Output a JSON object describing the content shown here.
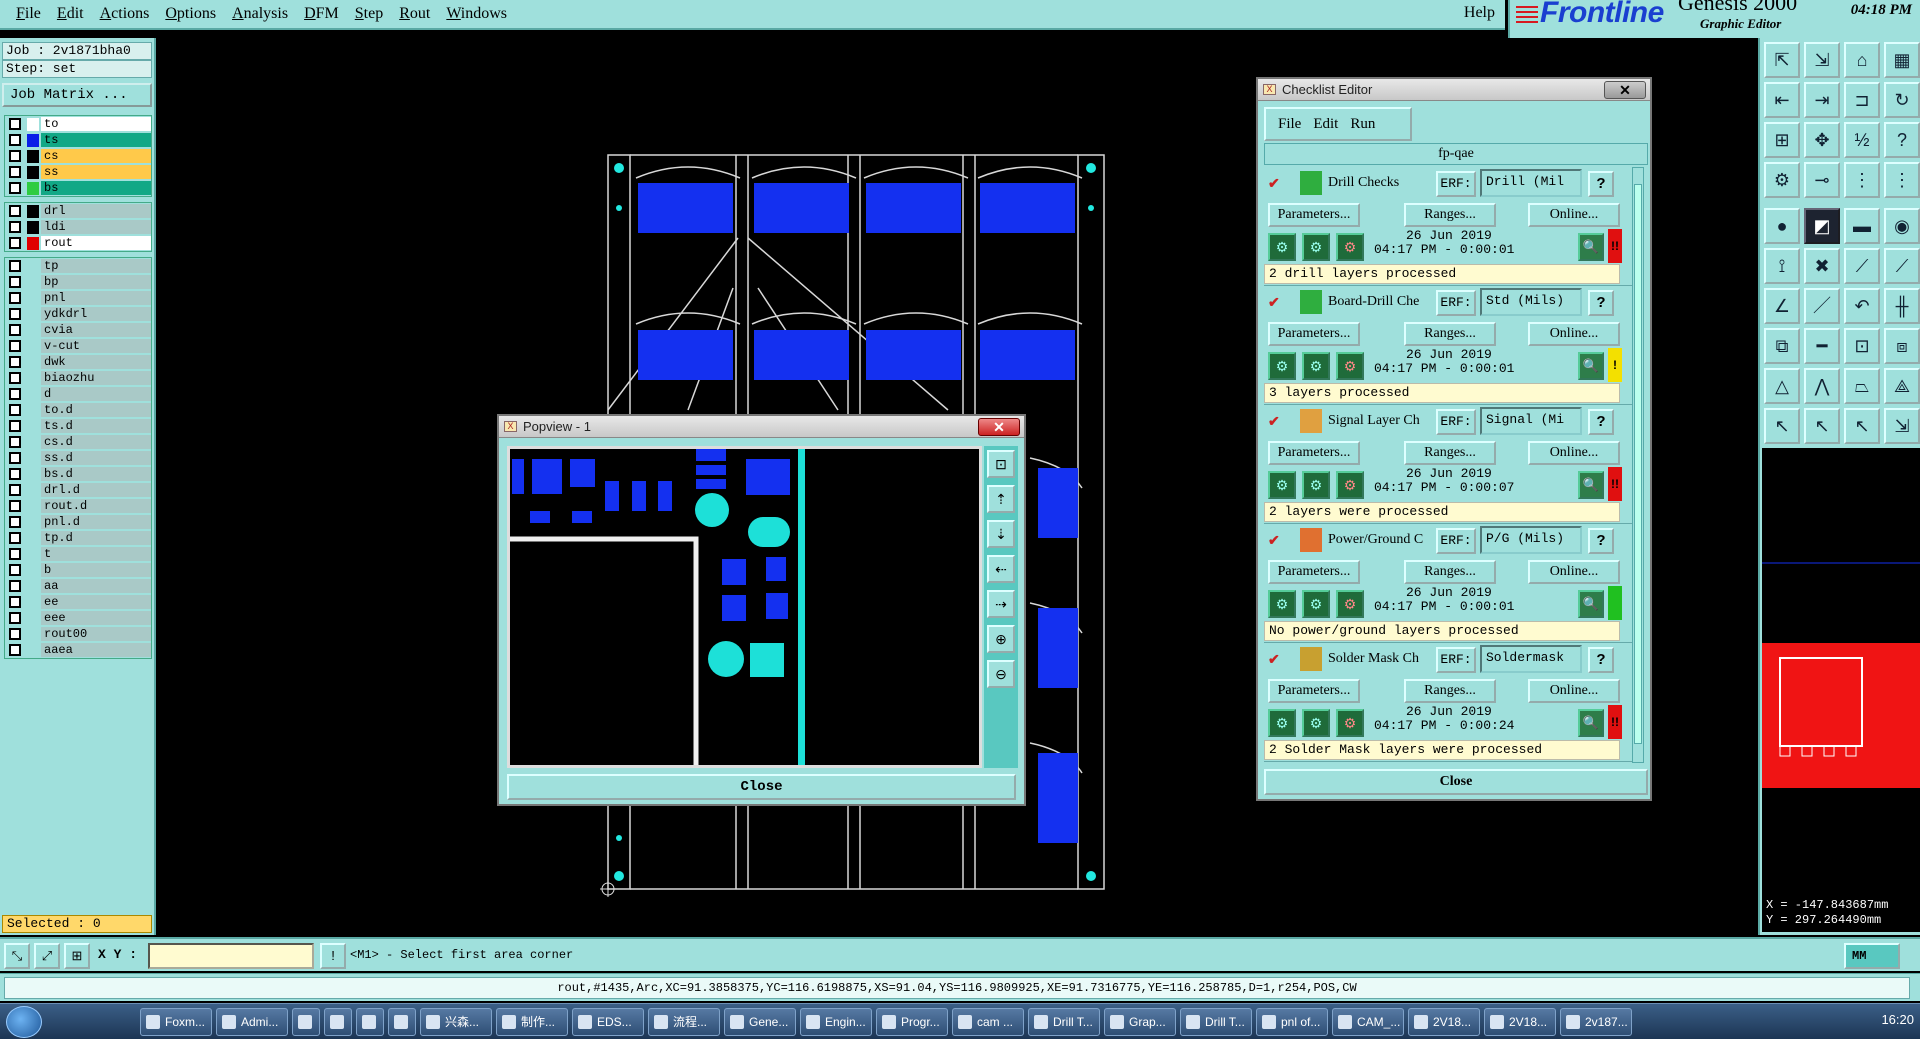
{
  "menubar": {
    "items": [
      "File",
      "Edit",
      "Actions",
      "Options",
      "Analysis",
      "DFM",
      "Step",
      "Rout",
      "Windows"
    ],
    "help": "Help"
  },
  "brand": {
    "logo": "Frontline",
    "product": "Genesis 2000",
    "subtitle": "Graphic Editor",
    "time": "04:18 PM"
  },
  "job": {
    "job_line": "Job : 2v1871bha0",
    "step_line": "Step: set",
    "job_matrix": "Job Matrix ..."
  },
  "layers": {
    "group1": [
      {
        "name": "to",
        "color": "#ffffff",
        "bg": "#ffffff"
      },
      {
        "name": "ts",
        "color": "#0a1ee8",
        "bg": "#11a886"
      },
      {
        "name": "cs",
        "color": "#000000",
        "bg": "#ffc94a"
      },
      {
        "name": "ss",
        "color": "#000000",
        "bg": "#ffc94a"
      },
      {
        "name": "bs",
        "color": "#2ecc40",
        "bg": "#11a886"
      }
    ],
    "group2": [
      {
        "name": "drl",
        "color": "#000000",
        "bg": "#a9c9c7"
      },
      {
        "name": "ldi",
        "color": "#000000",
        "bg": "#a9c9c7"
      },
      {
        "name": "rout",
        "color": "#e00000",
        "bg": "#ffffff"
      }
    ],
    "group3": [
      "tp",
      "bp",
      "pnl",
      "ydkdrl",
      "cvia",
      "v-cut",
      "dwk",
      "biaozhu",
      "d",
      "to.d",
      "ts.d",
      "cs.d",
      "ss.d",
      "bs.d",
      "drl.d",
      "rout.d",
      "pnl.d",
      "tp.d",
      "t",
      "b",
      "aa",
      "ee",
      "eee",
      "rout00",
      "aaea"
    ],
    "selected": "Selected : 0"
  },
  "popview": {
    "title": "Popview - 1",
    "close": "Close"
  },
  "checklist": {
    "title": "Checklist Editor",
    "menu": [
      "File",
      "Edit",
      "Run"
    ],
    "name": "fp-qae",
    "erf_label": "ERF:",
    "params_label": "Parameters...",
    "ranges_label": "Ranges...",
    "online_label": "Online...",
    "items": [
      {
        "name": "Drill Checks",
        "erf": "Drill (Mil",
        "date": "26 Jun 2019",
        "time": "04:17 PM - 0:00:01",
        "result": "2 drill layers processed",
        "status_color": "#e01010",
        "status_mark": "!!",
        "icon_color": "#2fae3f"
      },
      {
        "name": "Board-Drill Che",
        "erf": "Std (Mils)",
        "date": "26 Jun 2019",
        "time": "04:17 PM - 0:00:01",
        "result": "3 layers processed",
        "status_color": "#f3e000",
        "status_mark": "!",
        "icon_color": "#2fae3f"
      },
      {
        "name": "Signal Layer Ch",
        "erf": "Signal (Mi",
        "date": "26 Jun 2019",
        "time": "04:17 PM - 0:00:07",
        "result": "2 layers were processed",
        "status_color": "#e01010",
        "status_mark": "!!",
        "icon_color": "#e0a040"
      },
      {
        "name": "Power/Ground C",
        "erf": "P/G (Mils)",
        "date": "26 Jun 2019",
        "time": "04:17 PM - 0:00:01",
        "result": "No power/ground layers processed",
        "status_color": "#20c020",
        "status_mark": "",
        "icon_color": "#e07030"
      },
      {
        "name": "Solder Mask Ch",
        "erf": "Soldermask",
        "date": "26 Jun 2019",
        "time": "04:17 PM - 0:00:24",
        "result": "2 Solder Mask layers were processed",
        "status_color": "#e01010",
        "status_mark": "!!",
        "icon_color": "#c8a030"
      }
    ],
    "close": "Close"
  },
  "coords": {
    "x": "X = -147.843687mm",
    "y": "Y = 297.264490mm"
  },
  "command": {
    "xy_label": "X Y :",
    "xy_value": "",
    "prompt": "<M1> - Select first area corner",
    "units": "MM"
  },
  "status_text": "rout,#1435,Arc,XC=91.3858375,YC=116.6198875,XS=91.04,YS=116.9809925,XE=91.7316775,YE=116.258785,D=1,r254,POS,CW",
  "taskbar": {
    "tasks": [
      "Foxm...",
      "Admi...",
      "",
      "",
      "",
      "",
      "兴森...",
      "制作...",
      "EDS...",
      "流程...",
      "Gene...",
      "Engin...",
      "Progr...",
      "cam ...",
      "Drill T...",
      "Grap...",
      "Drill T...",
      "pnl of...",
      "CAM_...",
      "2V18...",
      "2V18...",
      "2v187..."
    ],
    "clock": "16:20"
  }
}
